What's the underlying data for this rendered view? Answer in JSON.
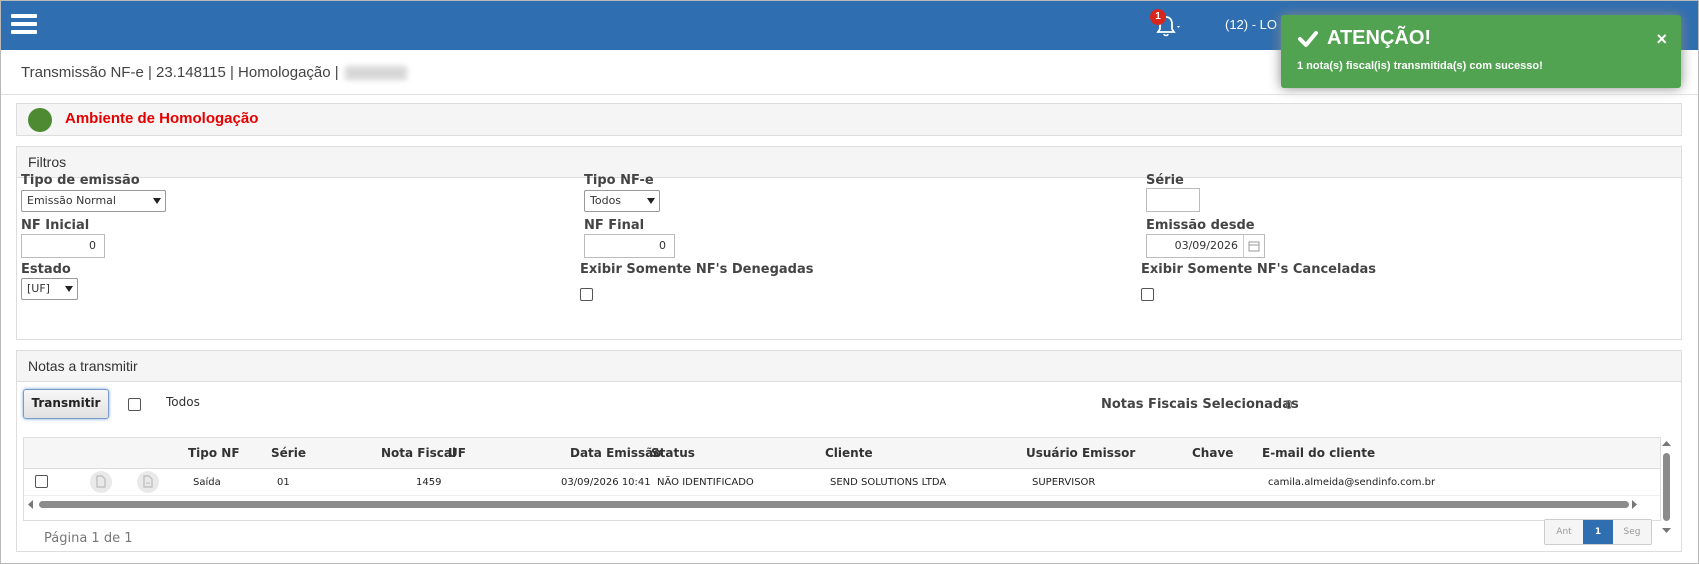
{
  "header": {
    "notification_count": "1",
    "user_text": "(12) - LO",
    "colors": {
      "topbar": "#2f6eb0",
      "badge": "#d9261c"
    }
  },
  "toast": {
    "title": "ATENÇÃO!",
    "message": "1 nota(s) fiscal(is) transmitida(s) com sucesso!",
    "close": "×",
    "color": "#51a351"
  },
  "page": {
    "title": "Transmissão NF-e | 23.148115 | Homologação |"
  },
  "environment": {
    "label": "Ambiente de Homologação",
    "dot_color": "#4d8a32",
    "label_color": "#e60000"
  },
  "filters": {
    "heading": "Filtros",
    "tipo_emissao": {
      "label": "Tipo de emissão",
      "value": "Emissão Normal"
    },
    "tipo_nfe": {
      "label": "Tipo NF-e",
      "value": "Todos"
    },
    "serie": {
      "label": "Série",
      "value": ""
    },
    "nf_inicial": {
      "label": "NF Inicial",
      "value": "0"
    },
    "nf_final": {
      "label": "NF Final",
      "value": "0"
    },
    "emissao_desde": {
      "label": "Emissão desde",
      "value": "03/09/2026"
    },
    "estado": {
      "label": "Estado",
      "value": "[UF]"
    },
    "denegadas": {
      "label": "Exibir Somente NF's Denegadas"
    },
    "canceladas": {
      "label": "Exibir Somente NF's Canceladas"
    }
  },
  "notes": {
    "heading": "Notas a transmitir",
    "transmit_label": "Transmitir",
    "todos_label": "Todos",
    "selected_label": "Notas Fiscais Selecionadas",
    "selected_count": "0",
    "columns": [
      "Tipo NF",
      "Série",
      "Nota Fiscal",
      "UF",
      "Data Emissão",
      "Status",
      "Cliente",
      "Usuário Emissor",
      "Chave",
      "E-mail do cliente"
    ],
    "rows": [
      {
        "tipo": "Saída",
        "serie": "01",
        "nota": "1459",
        "uf": "",
        "data": "03/09/2026 10:41",
        "status": "NÃO IDENTIFICADO",
        "cliente": "SEND SOLUTIONS LTDA",
        "usuario": "SUPERVISOR",
        "chave": "",
        "email": "camila.almeida@sendinfo.com.br"
      }
    ],
    "pager_text": "Página 1 de 1",
    "pager_prev": "Ant",
    "pager_current": "1",
    "pager_next": "Seg"
  }
}
